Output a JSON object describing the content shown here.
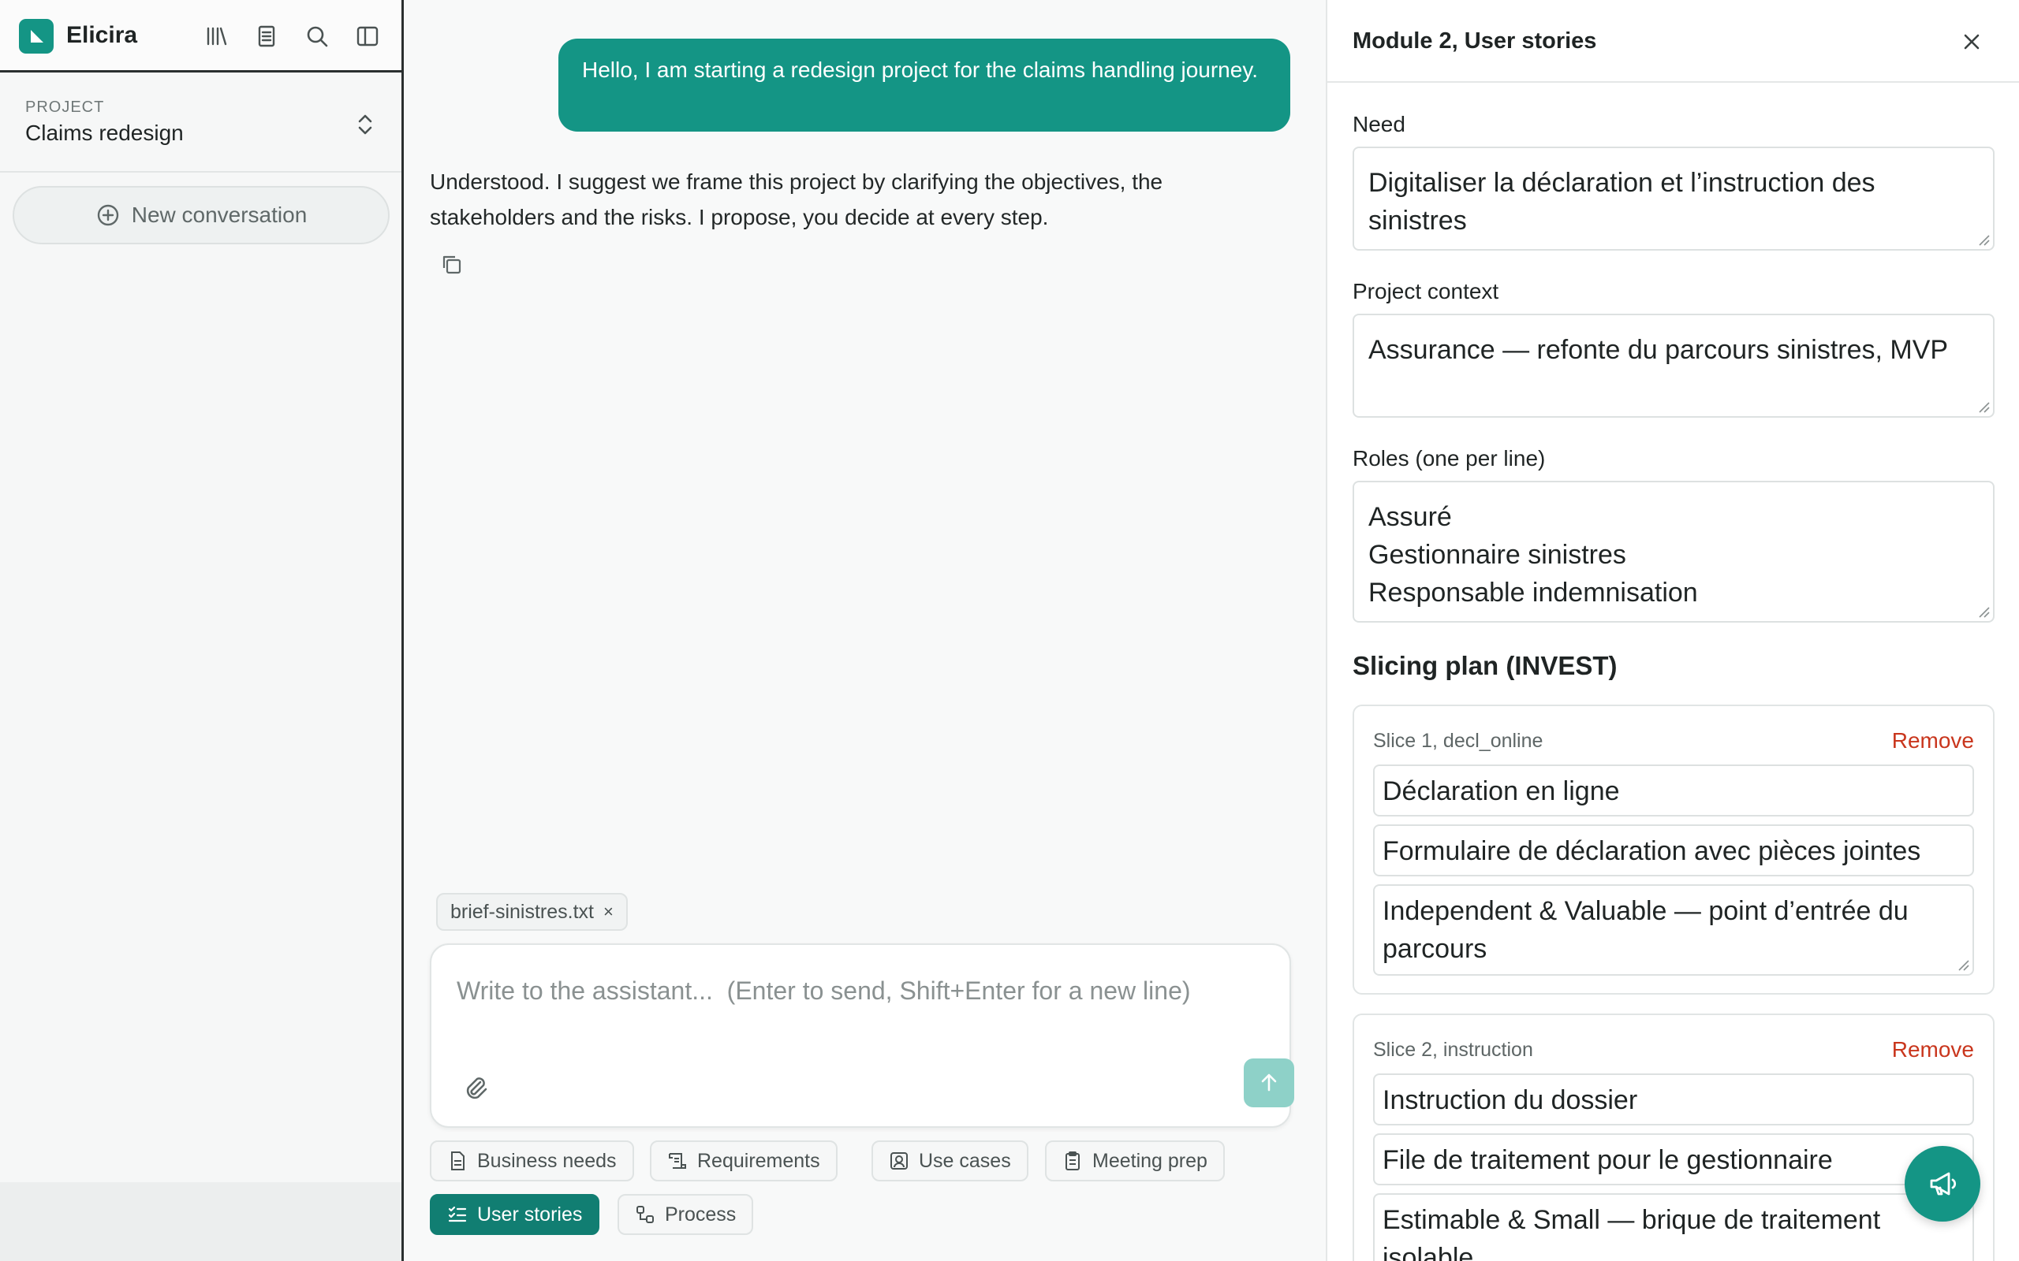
{
  "app": {
    "name": "Elicira"
  },
  "project": {
    "label": "PROJECT",
    "name": "Claims redesign"
  },
  "sidebar": {
    "new_conversation": "New conversation"
  },
  "chat": {
    "user_message": "Hello, I am starting a redesign project for the claims handling journey.",
    "assistant_message": "Understood. I suggest we frame this project by clarifying the objectives, the stakeholders and the risks. I propose, you decide at every step.",
    "attachment": "brief-sinistres.txt",
    "attachment_remove": "×",
    "composer_placeholder": "Write to the assistant...  (Enter to send, Shift+Enter for a new line)"
  },
  "modules": [
    {
      "label": "Business needs",
      "icon": "document-icon"
    },
    {
      "label": "Requirements",
      "icon": "scroll-icon"
    },
    {
      "label": "Use cases",
      "icon": "user-card-icon"
    },
    {
      "label": "Meeting prep",
      "icon": "clipboard-icon"
    },
    {
      "label": "User stories",
      "icon": "checklist-icon",
      "active": true
    },
    {
      "label": "Process",
      "icon": "flow-icon"
    }
  ],
  "panel": {
    "title": "Module 2, User stories",
    "need_label": "Need",
    "need_value": "Digitaliser la déclaration et l’instruction des sinistres",
    "context_label": "Project context",
    "context_value": "Assurance — refonte du parcours sinistres, MVP",
    "roles_label": "Roles (one per line)",
    "roles": [
      "Assuré",
      "Gestionnaire sinistres",
      "Responsable indemnisation"
    ],
    "slicing_title": "Slicing plan (INVEST)",
    "remove_label": "Remove",
    "slices": [
      {
        "label": "Slice 1, decl_online",
        "title": "Déclaration en ligne",
        "description": "Formulaire de déclaration avec pièces jointes",
        "rationale": "Independent & Valuable — point d’entrée du parcours"
      },
      {
        "label": "Slice 2, instruction",
        "title": "Instruction du dossier",
        "description": "File de traitement pour le gestionnaire",
        "rationale": "Estimable & Small — brique de traitement isolable"
      }
    ]
  },
  "colors": {
    "accent": "#149585",
    "accent_dark": "#117e72",
    "send_disabled": "#8ed1c8",
    "danger": "#c9361d"
  }
}
